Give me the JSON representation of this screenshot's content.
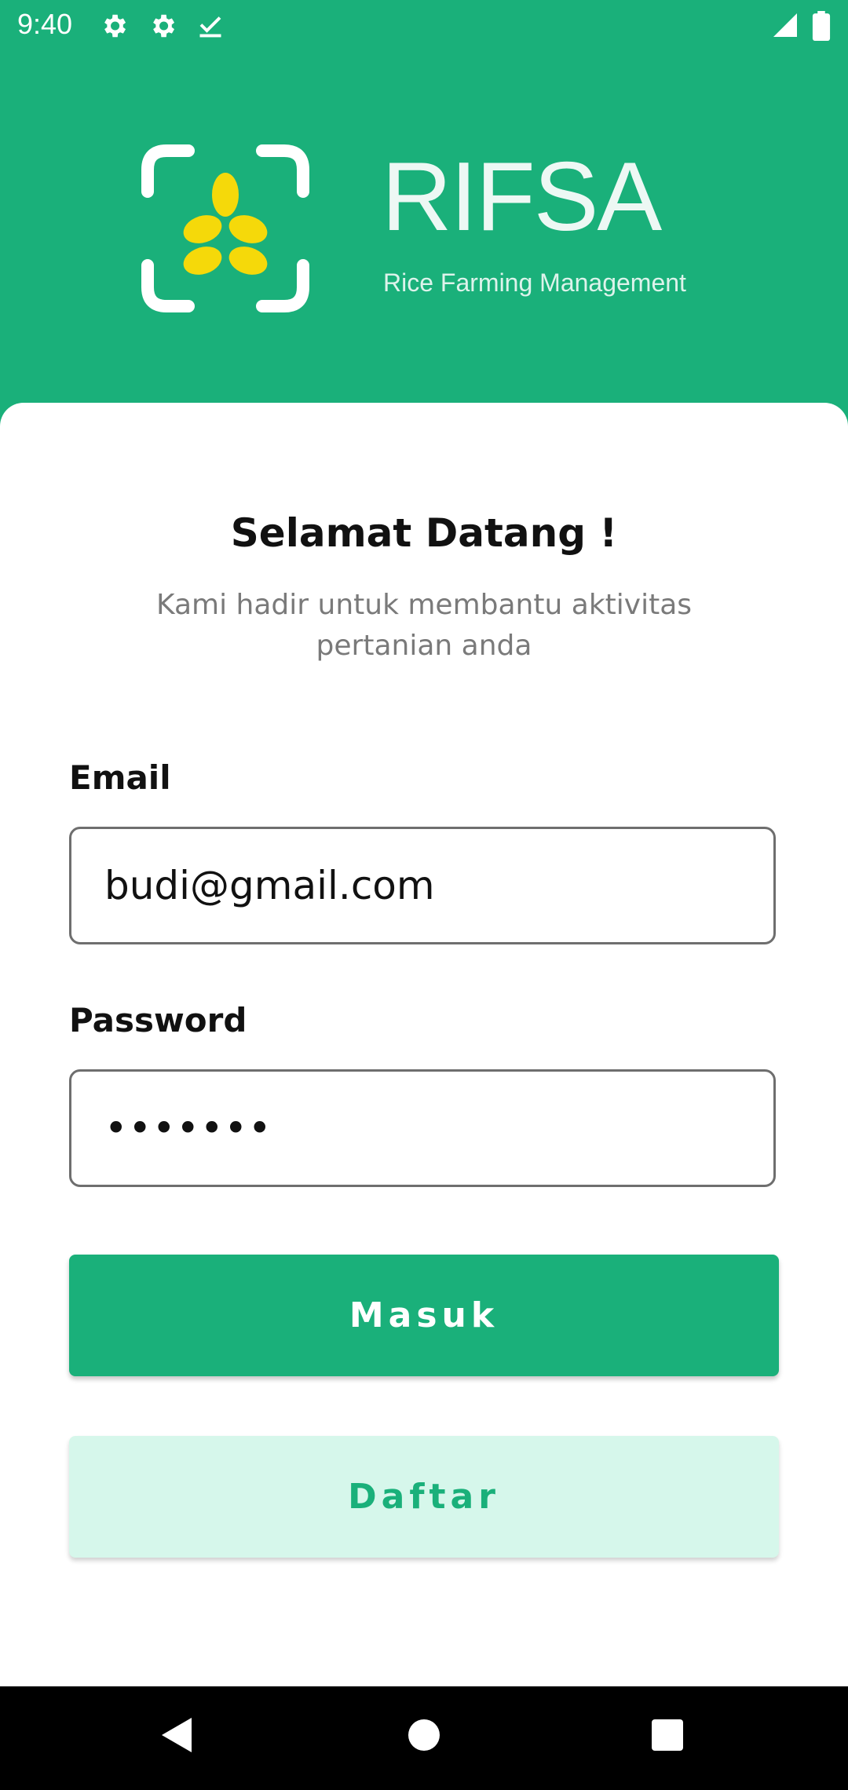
{
  "status_bar": {
    "time": "9:40",
    "icons": [
      "gear-icon",
      "gear-icon",
      "download-done-icon",
      "signal-icon",
      "battery-icon"
    ]
  },
  "brand": {
    "name": "RIFSA",
    "tagline": "Rice Farming Management",
    "logo": "rice-grain-scan-logo"
  },
  "welcome": {
    "title": "Selamat Datang !",
    "subtitle": "Kami hadir untuk membantu aktivitas pertanian anda"
  },
  "form": {
    "email_label": "Email",
    "email_value": "budi@gmail.com",
    "password_label": "Password",
    "password_value": "•••••••"
  },
  "buttons": {
    "login_label": "Masuk",
    "register_label": "Daftar"
  },
  "nav": {
    "back": "back-icon",
    "home": "home-icon",
    "recents": "recents-icon"
  },
  "colors": {
    "primary": "#1AB07A",
    "primary_light": "#D6F7EB",
    "logo_accent": "#F5D90A"
  }
}
